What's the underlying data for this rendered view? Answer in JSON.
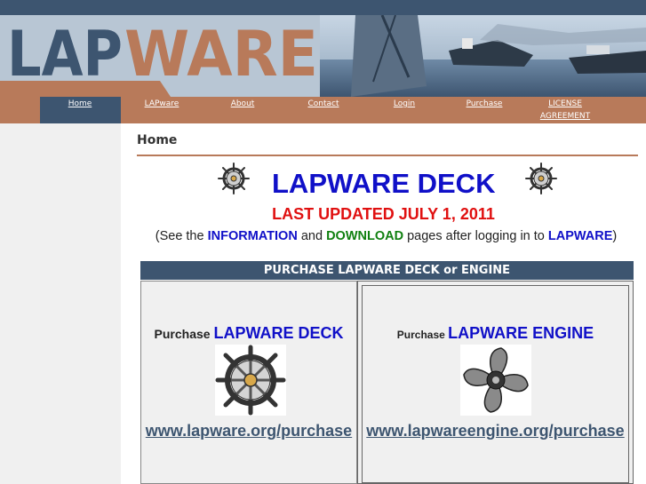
{
  "banner": {
    "logo_text": "LAPWARE"
  },
  "nav": {
    "items": [
      {
        "label": "Home"
      },
      {
        "label": "LAPware"
      },
      {
        "label": "About"
      },
      {
        "label": "Contact"
      },
      {
        "label": "Login"
      },
      {
        "label": "Purchase"
      },
      {
        "label": "LICENSE AGREEMENT"
      }
    ]
  },
  "main": {
    "page_title": "Home",
    "heading": "LAPWARE DECK",
    "updated": "LAST UPDATED JULY 1, 2011",
    "see": {
      "prefix": "(See the ",
      "information": "INFORMATION",
      "and": " and ",
      "download": "DOWNLOAD",
      "middle": " pages after logging in to ",
      "lapware": "LAPWARE",
      "suffix": ")"
    },
    "purchase_table": {
      "header": "PURCHASE LAPWARE DECK or ENGINE",
      "left": {
        "label_small": "Purchase ",
        "label_big": "LAPWARE DECK",
        "link": "www.lapware.org/purchase"
      },
      "right": {
        "label_small": "Purchase ",
        "label_big": "LAPWARE ENGINE",
        "link": "www.lapwareengine.org/purchase"
      }
    }
  },
  "colors": {
    "navy": "#3d5570",
    "copper": "#b87a5a",
    "blue": "#1010c8",
    "red": "#e01010",
    "green": "#108010"
  }
}
